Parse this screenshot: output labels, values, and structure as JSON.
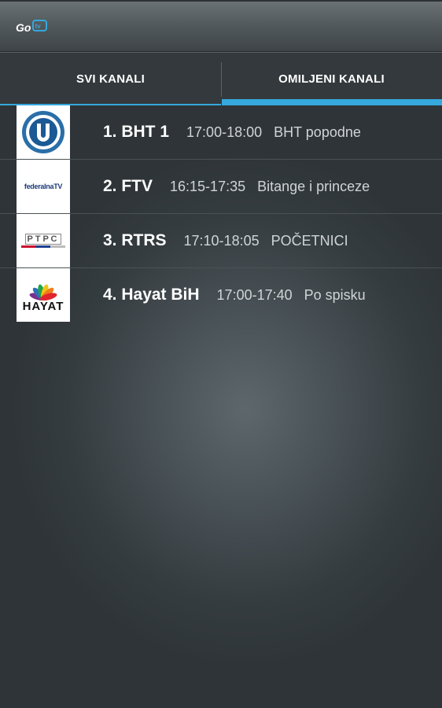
{
  "app": {
    "logo_text": "Go tv"
  },
  "tabs": [
    {
      "label": "SVI KANALI",
      "selected": false
    },
    {
      "label": "OMILJENI KANALI",
      "selected": true
    }
  ],
  "channels": [
    {
      "name": "1. BHT 1",
      "time": "17:00-18:00",
      "show": "BHT popodne",
      "logo": "bht1-logo"
    },
    {
      "name": "2. FTV",
      "time": "16:15-17:35",
      "show": "Bitange i princeze",
      "logo": "ftv-logo",
      "logo_text": "federalnaTV"
    },
    {
      "name": "3. RTRS",
      "time": "17:10-18:05",
      "show": "POČETNICI",
      "logo": "rtrs-logo",
      "logo_text": "РТРС"
    },
    {
      "name": "4. Hayat BiH",
      "time": "17:00-17:40",
      "show": "Po spisku",
      "logo": "hayat-logo",
      "logo_text": "HAYAT"
    }
  ],
  "colors": {
    "accent": "#35a8dc",
    "tab_bg": "#33393c",
    "text_secondary": "#d0d4d6"
  }
}
